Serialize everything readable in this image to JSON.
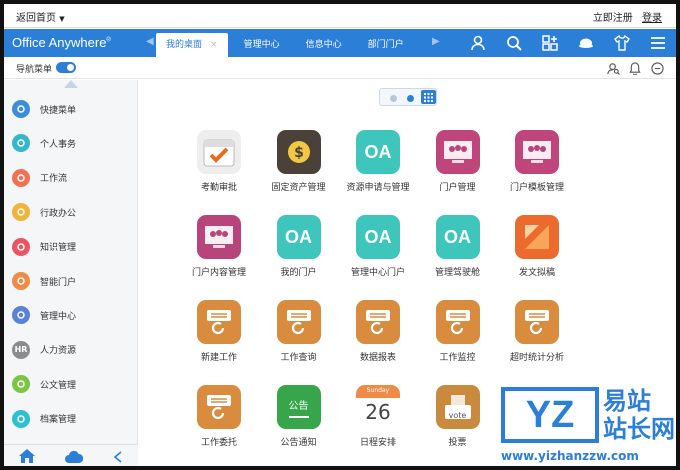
{
  "topbar": {
    "back_label": "返回首页",
    "register": "立即注册",
    "login": "登录"
  },
  "header": {
    "logo": "Office Anywhere",
    "logo_mark": "®",
    "tabs": [
      {
        "label": "我的桌面",
        "active": true,
        "close": "×"
      },
      {
        "label": "管理中心"
      },
      {
        "label": "信息中心"
      },
      {
        "label": "部门门户"
      }
    ],
    "icons": [
      "user-icon",
      "search-icon",
      "apps-icon",
      "chat-icon",
      "shirt-icon",
      "menu-icon"
    ]
  },
  "navrow": {
    "label": "导航菜单",
    "toggle_on": true,
    "icons": [
      "user-search-icon",
      "bell-icon",
      "message-icon"
    ]
  },
  "sidebar": {
    "items": [
      {
        "label": "快捷菜单",
        "color": "#3e8ddb",
        "icon": "share-icon"
      },
      {
        "label": "个人事务",
        "color": "#36b6c9",
        "icon": "person-icon"
      },
      {
        "label": "工作流",
        "color": "#f07255",
        "icon": "flow-icon"
      },
      {
        "label": "行政办公",
        "color": "#f2b33a",
        "icon": "layers-icon"
      },
      {
        "label": "知识管理",
        "color": "#ea5562",
        "icon": "book-icon"
      },
      {
        "label": "智能门户",
        "color": "#f08a47",
        "icon": "portal-icon"
      },
      {
        "label": "管理中心",
        "color": "#5b82d9",
        "icon": "manage-icon"
      },
      {
        "label": "人力资源",
        "color": "#8c8c8c",
        "icon": "hr-icon",
        "text": "HR"
      },
      {
        "label": "公文管理",
        "color": "#7cc444",
        "icon": "document-icon"
      },
      {
        "label": "档案管理",
        "color": "#2ec0d1",
        "icon": "archive-icon"
      }
    ],
    "bottom_icons": [
      "home-icon",
      "cloud-icon",
      "collapse-icon"
    ]
  },
  "colors": {
    "accent": "#2b7fd6"
  },
  "apps": [
    {
      "label": "考勤审批",
      "icon": "calendar-check-icon",
      "bg": "#eeeeee"
    },
    {
      "label": "固定资产管理",
      "icon": "wallet-icon",
      "bg": "#4a4238"
    },
    {
      "label": "资源申请与管理",
      "icon": "oa-icon",
      "bg": "#3ec6bd",
      "text": "OA"
    },
    {
      "label": "门户管理",
      "icon": "portal-screen-icon",
      "bg": "#c0457a"
    },
    {
      "label": "门户模板管理",
      "icon": "portal-template-icon",
      "bg": "#c0457a"
    },
    {
      "label": "门户内容管理",
      "icon": "portal-content-icon",
      "bg": "#b7457c"
    },
    {
      "label": "我的门户",
      "icon": "oa-icon",
      "bg": "#3ec6bd",
      "text": "OA"
    },
    {
      "label": "管理中心门户",
      "icon": "oa-icon",
      "bg": "#3ec6bd",
      "text": "OA"
    },
    {
      "label": "管理驾驶舱",
      "icon": "oa-icon",
      "bg": "#3ec6bd",
      "text": "OA"
    },
    {
      "label": "发文拟稿",
      "icon": "draft-icon",
      "bg": "#ec6a2e"
    },
    {
      "label": "新建工作",
      "icon": "work-new-icon",
      "bg": "#d98b3e"
    },
    {
      "label": "工作查询",
      "icon": "work-query-icon",
      "bg": "#d98b3e"
    },
    {
      "label": "数据报表",
      "icon": "report-icon",
      "bg": "#d98b3e"
    },
    {
      "label": "工作监控",
      "icon": "work-monitor-icon",
      "bg": "#d98b3e"
    },
    {
      "label": "超时统计分析",
      "icon": "timeout-stats-icon",
      "bg": "#d98b3e"
    },
    {
      "label": "工作委托",
      "icon": "work-delegate-icon",
      "bg": "#d98b3e"
    },
    {
      "label": "公告通知",
      "icon": "notice-board-icon",
      "bg": "#37a64a",
      "text": "公告"
    },
    {
      "label": "日程安排",
      "icon": "calendar-day-icon",
      "bg": "#f08a47",
      "text": "26",
      "sub": "Sunday"
    },
    {
      "label": "投票",
      "icon": "vote-icon",
      "bg": "#c98a3e",
      "text": "vote"
    }
  ],
  "watermark": {
    "logo": "YZ",
    "cn": "易站\n站长网",
    "url": "www.yizhanzzw.com"
  }
}
